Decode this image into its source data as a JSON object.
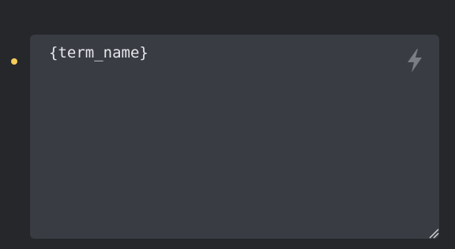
{
  "status": {
    "indicator_color": "#f5cc5c"
  },
  "editor": {
    "content": "{term_name}",
    "background": "#393c43",
    "text_color": "#e6e8eb",
    "action_icon": "lightning-bolt-icon",
    "resize_icon": "resize-handle-icon"
  },
  "page": {
    "background": "#25272b"
  }
}
